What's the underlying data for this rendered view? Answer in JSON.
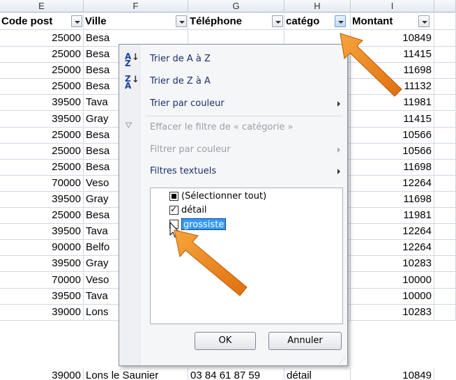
{
  "columns": {
    "letters": [
      "E",
      "F",
      "G",
      "H",
      "I"
    ],
    "headers": [
      "Code post",
      "Ville",
      "Téléphone",
      "catégo",
      "Montant"
    ]
  },
  "rows": [
    {
      "code": "25000",
      "ville": "Besa",
      "montant": "10849"
    },
    {
      "code": "25000",
      "ville": "Besa",
      "montant": "11415"
    },
    {
      "code": "25000",
      "ville": "Besa",
      "montant": "11698"
    },
    {
      "code": "25000",
      "ville": "Besa",
      "montant": "11132"
    },
    {
      "code": "39500",
      "ville": "Tava",
      "montant": "11981"
    },
    {
      "code": "39500",
      "ville": "Gray",
      "montant": "11415"
    },
    {
      "code": "25000",
      "ville": "Besa",
      "montant": "10566"
    },
    {
      "code": "25000",
      "ville": "Besa",
      "montant": "10566"
    },
    {
      "code": "25000",
      "ville": "Besa",
      "montant": "11698"
    },
    {
      "code": "70000",
      "ville": "Veso",
      "montant": "12264"
    },
    {
      "code": "39500",
      "ville": "Gray",
      "montant": "11698"
    },
    {
      "code": "25000",
      "ville": "Besa",
      "montant": "11981"
    },
    {
      "code": "39500",
      "ville": "Tava",
      "montant": "12264"
    },
    {
      "code": "90000",
      "ville": "Belfo",
      "montant": "12264"
    },
    {
      "code": "39500",
      "ville": "Gray",
      "montant": "10283"
    },
    {
      "code": "70000",
      "ville": "Veso",
      "montant": "10000"
    },
    {
      "code": "39500",
      "ville": "Tava",
      "montant": "10000"
    },
    {
      "code": "39000",
      "ville": "Lons",
      "montant": "10283"
    }
  ],
  "last_row": {
    "code": "39000",
    "ville": "Lons le Saunier",
    "telephone": "03 84 61 87 59",
    "categorie": "détail",
    "montant": "10849"
  },
  "menu": {
    "sort_az": "Trier de A à Z",
    "sort_za": "Trier de Z à A",
    "sort_color": "Trier par couleur",
    "clear_filter": "Effacer le filtre de « catégorie »",
    "filter_color": "Filtrer par couleur",
    "text_filters": "Filtres textuels",
    "list": [
      "(Sélectionner tout)",
      "détail",
      "grossiste"
    ],
    "ok": "OK",
    "cancel": "Annuler"
  },
  "colors": {
    "accent": "#3399ff",
    "arrow": "#f28c1c"
  }
}
